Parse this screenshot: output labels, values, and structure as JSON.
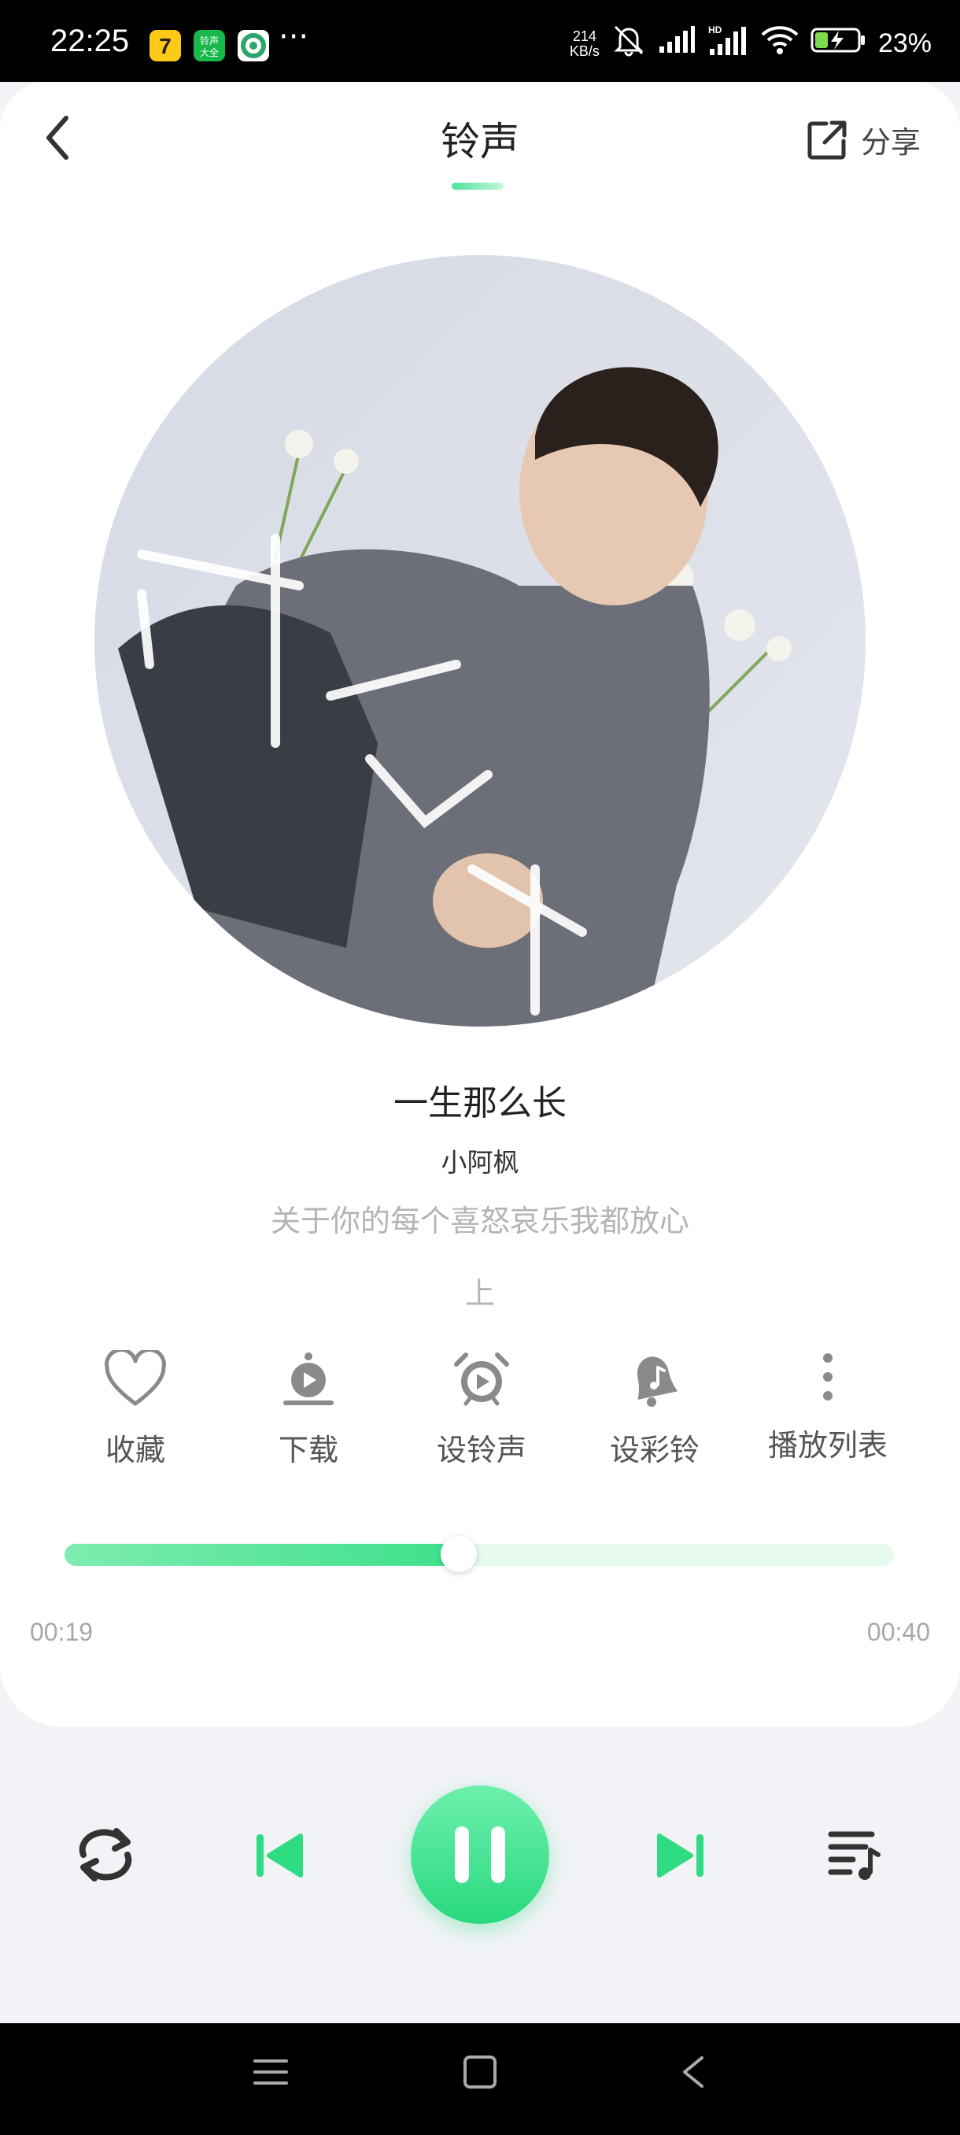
{
  "status_bar": {
    "time": "22:25",
    "network_speed_value": "214",
    "network_speed_unit": "KB/s",
    "battery_percent": "23%",
    "icons": [
      "app-icon-yellow",
      "app-icon-ringtone",
      "app-icon-green",
      "more-dots-icon",
      "mute-icon",
      "signal-icon",
      "hd-signal-icon",
      "wifi-icon",
      "battery-charging-icon"
    ],
    "app_icon_ringtone_text": "铃声大全",
    "more_dots": "···"
  },
  "header": {
    "title": "铃声",
    "share_label": "分享",
    "accent_color": "#4fe39a"
  },
  "song": {
    "title": "一生那么长",
    "artist": "小阿枫",
    "lyric_line_1": "关于你的每个喜怒哀乐我都放心",
    "lyric_line_2": "上"
  },
  "actions": [
    {
      "label": "收藏",
      "icon": "heart-icon"
    },
    {
      "label": "下载",
      "icon": "download-icon"
    },
    {
      "label": "设铃声",
      "icon": "alarm-ringtone-icon"
    },
    {
      "label": "设彩铃",
      "icon": "bell-music-icon"
    },
    {
      "label": "播放列表",
      "icon": "more-vertical-icon"
    }
  ],
  "progress": {
    "current_time": "00:19",
    "total_time": "00:40",
    "fraction": 0.475
  },
  "controls": {
    "icons": [
      "repeat-icon",
      "previous-icon",
      "pause-icon",
      "next-icon",
      "playlist-icon"
    ],
    "play_state": "playing"
  },
  "colors": {
    "accent": "#2fdc82",
    "background_lower": "#f1f3f7",
    "card": "#ffffff"
  }
}
